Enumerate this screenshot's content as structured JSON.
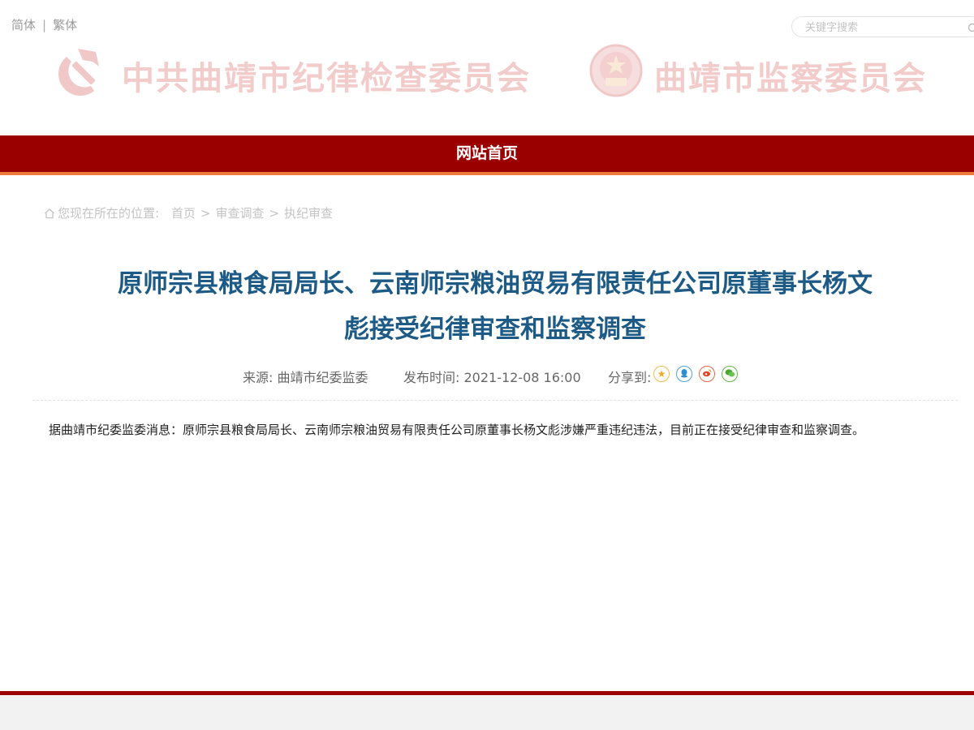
{
  "header": {
    "lang_simplified": "简体",
    "lang_separator": "|",
    "lang_traditional": "繁体",
    "search_placeholder": "关键字搜索",
    "org_left": "中共曲靖市纪律检查委员会",
    "org_right": "曲靖市监察委员会"
  },
  "nav": {
    "home": "网站首页"
  },
  "breadcrumb": {
    "prefix": "您现在所在的位置:",
    "items": [
      "首页",
      "审查调查",
      "执纪审查"
    ],
    "separator": ">"
  },
  "article": {
    "title_line1": "原师宗县粮食局局长、云南师宗粮油贸易有限责任公司原董事长杨文",
    "title_line2": "彪接受纪律审查和监察调查",
    "source": "来源: 曲靖市纪委监委",
    "time": "发布时间: 2021-12-08 16:00",
    "share_label": "分享到:",
    "share_icons": [
      "star-icon",
      "qq-icon",
      "weibo-icon",
      "wechat-icon"
    ],
    "body": "据曲靖市纪委监委消息：原师宗县粮食局局长、云南师宗粮油贸易有限责任公司原董事长杨文彪涉嫌严重违纪违法，目前正在接受纪律审查和监察调查。"
  },
  "colors": {
    "nav_bg": "#9b0000",
    "nav_underline": "#ee7a3b",
    "title": "#1d5b86",
    "emblem_faded": "#f2cbcb"
  }
}
